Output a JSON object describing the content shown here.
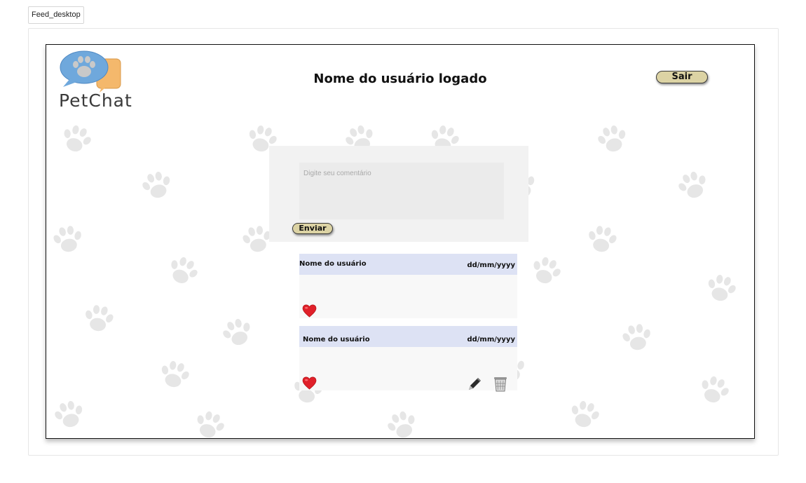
{
  "frame": {
    "label": "Feed_desktop"
  },
  "header": {
    "brand_name": "PetChat",
    "title": "Nome do usuário logado",
    "logout_label": "Sair"
  },
  "composer": {
    "placeholder": "Digite seu comentário",
    "value": "",
    "send_label": "Enviar"
  },
  "posts": [
    {
      "user": "Nome do usuário",
      "date": "dd/mm/yyyy",
      "body": "",
      "like_icon": "heart-icon"
    },
    {
      "user": "Nome do usuário",
      "date": "dd/mm/yyyy",
      "body": "",
      "like_icon": "heart-icon",
      "edit_icon": "pen-icon",
      "delete_icon": "trash-icon"
    }
  ],
  "colors": {
    "button_fill": "#dcd3a4",
    "post_header": "#dde2f4",
    "composer_bg": "#f2f2f2",
    "heart": "#e0202a",
    "logo_blue": "#6fa8dc",
    "logo_orange": "#f4b86c"
  }
}
